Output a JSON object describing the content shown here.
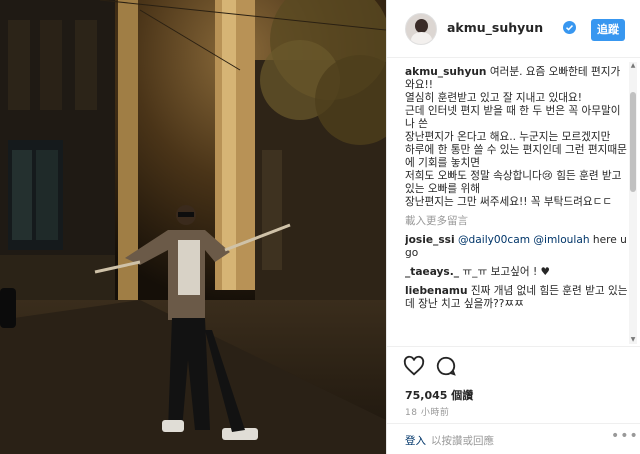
{
  "header": {
    "username": "akmu_suhyun",
    "follow_label": "追蹤"
  },
  "caption": {
    "username": "akmu_suhyun",
    "text": "여러분. 요즘 오빠한테 편지가 와요!!\n열심히 훈련받고 있고 잘 지내고 있대요!\n근데 인터넷 편지 받을 때 한 두 번은 꼭 아무말이나 쓴\n장난편지가 온다고 해요.. 누군지는 모르겠지만\n하루에 한 통만 쓸 수 있는 편지인데 그런 편지때문에 기회를 놓치면\n저희도 오빠도 정말 속상합니다😢 힘든 훈련 받고있는 오빠를 위해\n장난편지는 그만 써주세요!! 꼭 부탁드려요ㄷㄷ"
  },
  "load_more": "載入更多留言",
  "comments": [
    {
      "user": "josie_ssi",
      "mentions": "@daily00cam @imloulah",
      "text": " here u go"
    },
    {
      "user": "_taeays._",
      "mentions": "",
      "text": " ㅠ_ㅠ 보고싶어 ! ♥"
    },
    {
      "user": "liebenamu",
      "mentions": "",
      "text": " 진짜 개념 없네 힘든 훈련 받고 있는데 장난 치고 싶을까??ㅉㅉ"
    }
  ],
  "likes": "75,045 個讚",
  "timestamp": "18 小時前",
  "footer": {
    "login_label": "登入",
    "login_text": "以按讚或回應",
    "more_icon": "more-icon"
  },
  "icons": [
    "verified-badge-icon",
    "heart-icon",
    "comment-icon",
    "more-icon",
    "scroll-up-icon",
    "scroll-down-icon"
  ],
  "colors": {
    "accent": "#3897f0",
    "link": "#003569",
    "muted": "#999999"
  }
}
